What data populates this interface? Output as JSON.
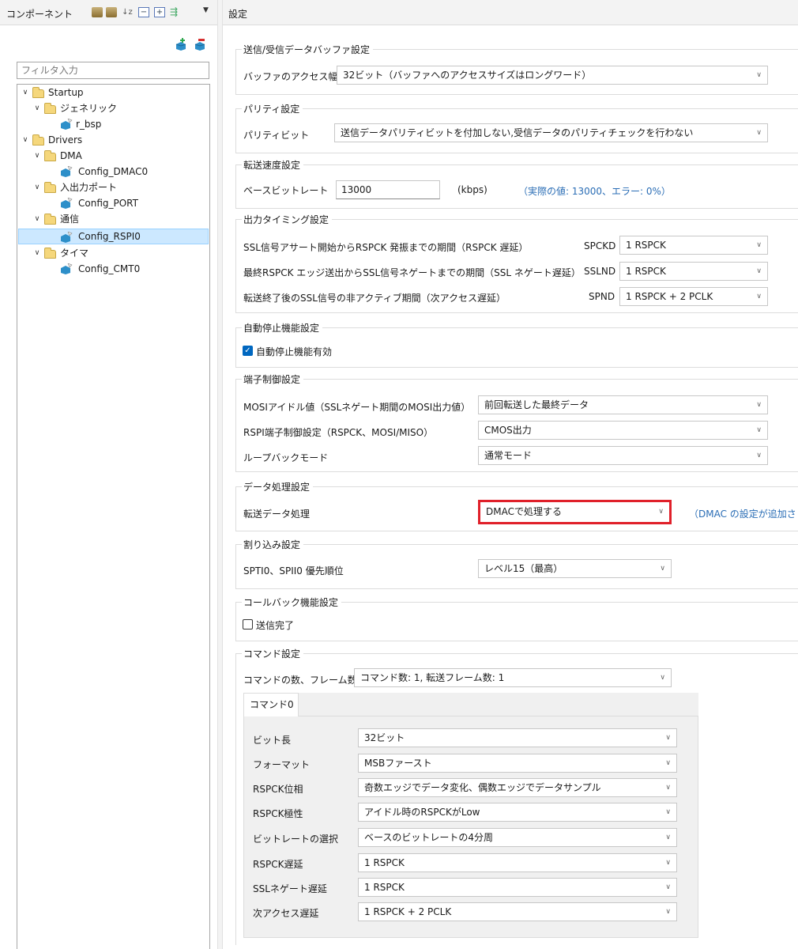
{
  "left": {
    "title": "コンポーネント",
    "filter_placeholder": "フィルタ入力",
    "tree": [
      {
        "label": "Startup",
        "icon": "folder"
      },
      {
        "label": "ジェネリック",
        "icon": "folder"
      },
      {
        "label": "r_bsp",
        "icon": "component"
      },
      {
        "label": "Drivers",
        "icon": "folder"
      },
      {
        "label": "DMA",
        "icon": "folder"
      },
      {
        "label": "Config_DMAC0",
        "icon": "component"
      },
      {
        "label": "入出力ポート",
        "icon": "folder"
      },
      {
        "label": "Config_PORT",
        "icon": "component"
      },
      {
        "label": "通信",
        "icon": "folder"
      },
      {
        "label": "Config_RSPI0",
        "icon": "component",
        "selected": true
      },
      {
        "label": "タイマ",
        "icon": "folder"
      },
      {
        "label": "Config_CMT0",
        "icon": "component"
      }
    ]
  },
  "right": {
    "title": "設定",
    "groups": {
      "buffer": {
        "title": "送信/受信データバッファ設定",
        "access_label": "バッファのアクセス幅",
        "access_value": "32ビット（バッファへのアクセスサイズはロングワード）"
      },
      "parity": {
        "title": "パリティ設定",
        "bit_label": "パリティビット",
        "bit_value": "送信データパリティビットを付加しない,受信データのパリティチェックを行わない"
      },
      "speed": {
        "title": "転送速度設定",
        "base_label": "ベースビットレート",
        "base_value": "13000",
        "unit": "(kbps)",
        "actual": "（実際の値: 13000、エラー: 0%）"
      },
      "timing": {
        "title": "出力タイミング設定",
        "rows": [
          {
            "label": "SSL信号アサート開始からRSPCK 発振までの期間（RSPCK 遅延）",
            "reg": "SPCKD",
            "value": "1 RSPCK"
          },
          {
            "label": "最終RSPCK エッジ送出からSSL信号ネゲートまでの期間（SSL ネゲート遅延）",
            "reg": "SSLND",
            "value": "1 RSPCK"
          },
          {
            "label": "転送終了後のSSL信号の非アクティブ期間（次アクセス遅延）",
            "reg": "SPND",
            "value": "1 RSPCK + 2 PCLK"
          }
        ]
      },
      "autostop": {
        "title": "自動停止機能設定",
        "checkbox_label": "自動停止機能有効",
        "checked": true
      },
      "pin": {
        "title": "端子制御設定",
        "rows": [
          {
            "label": "MOSIアイドル値（SSLネゲート期間のMOSI出力値）",
            "value": "前回転送した最終データ"
          },
          {
            "label": "RSPI端子制御設定（RSPCK、MOSI/MISO）",
            "value": "CMOS出力"
          },
          {
            "label": "ループバックモード",
            "value": "通常モード"
          }
        ]
      },
      "data": {
        "title": "データ処理設定",
        "label": "転送データ処理",
        "value": "DMACで処理する",
        "note": "（DMAC の設定が追加さ"
      },
      "interrupt": {
        "title": "割り込み設定",
        "label": "SPTI0、SPII0 優先順位",
        "value": "レベル15（最高）"
      },
      "callback": {
        "title": "コールバック機能設定",
        "checkbox_label": "送信完了",
        "checked": false
      },
      "command": {
        "title": "コマンド設定",
        "count_label": "コマンドの数、フレーム数",
        "count_value": "コマンド数: 1, 転送フレーム数: 1",
        "tab_label": "コマンド0",
        "rows": [
          {
            "label": "ビット長",
            "value": "32ビット"
          },
          {
            "label": "フォーマット",
            "value": "MSBファースト"
          },
          {
            "label": "RSPCK位相",
            "value": "奇数エッジでデータ変化、偶数エッジでデータサンプル"
          },
          {
            "label": "RSPCK極性",
            "value": "アイドル時のRSPCKがLow"
          },
          {
            "label": "ビットレートの選択",
            "value": "ベースのビットレートの4分周"
          },
          {
            "label": "RSPCK遅延",
            "value": "1 RSPCK"
          },
          {
            "label": "SSLネゲート遅延",
            "value": "1 RSPCK"
          },
          {
            "label": "次アクセス遅延",
            "value": "1 RSPCK + 2 PCLK"
          }
        ]
      }
    }
  },
  "colors": {
    "highlight": "#e0202a",
    "link_blue": "#2a6db5",
    "selection": "#cce8ff",
    "checkbox_blue": "#0067c0"
  }
}
